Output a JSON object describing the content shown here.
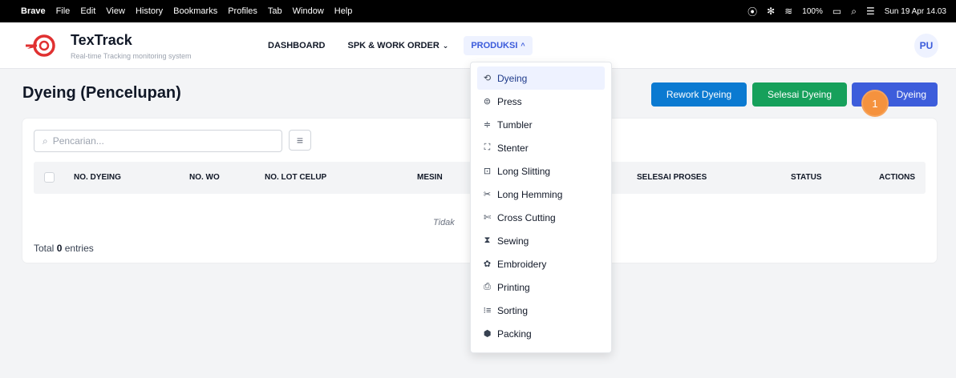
{
  "menubar": {
    "apple": "",
    "app": "Brave",
    "items": [
      "File",
      "Edit",
      "View",
      "History",
      "Bookmarks",
      "Profiles",
      "Tab",
      "Window",
      "Help"
    ],
    "battery": "100%",
    "datetime": "Sun 19 Apr 14.03"
  },
  "header": {
    "brand_name": "TexTrack",
    "brand_tagline": "Real-time Tracking monitoring system",
    "nav": [
      {
        "label": "DASHBOARD"
      },
      {
        "label": "SPK & WORK ORDER",
        "chevron": "⌄"
      },
      {
        "label": "PRODUKSI",
        "chevron": "^"
      }
    ],
    "avatar": "PU",
    "accent": "#3b5bdb"
  },
  "page": {
    "title": "Dyeing (Pencelupan)",
    "buttons": {
      "rework": "Rework Dyeing",
      "selesai": "Selesai Dyeing",
      "dyeing": "Dyeing"
    },
    "badge": "1",
    "search_placeholder": "Pencarian...",
    "columns": [
      "NO. DYEING",
      "NO. WO",
      "NO. LOT CELUP",
      "MESIN",
      "SELESAI PROSES",
      "STATUS",
      "ACTIONS"
    ],
    "empty_text": "Tidak",
    "total_prefix": "Total",
    "total_count": "0",
    "total_suffix": "entries"
  },
  "dropdown": {
    "items": [
      {
        "label": "Dyeing",
        "icon": "dyeing-icon"
      },
      {
        "label": "Press",
        "icon": "press-icon"
      },
      {
        "label": "Tumbler",
        "icon": "tumbler-icon"
      },
      {
        "label": "Stenter",
        "icon": "stenter-icon"
      },
      {
        "label": "Long Slitting",
        "icon": "slitting-icon"
      },
      {
        "label": "Long Hemming",
        "icon": "scissors-icon"
      },
      {
        "label": "Cross Cutting",
        "icon": "cutting-icon"
      },
      {
        "label": "Sewing",
        "icon": "sewing-icon"
      },
      {
        "label": "Embroidery",
        "icon": "embroidery-icon"
      },
      {
        "label": "Printing",
        "icon": "printer-icon"
      },
      {
        "label": "Sorting",
        "icon": "sorting-icon"
      },
      {
        "label": "Packing",
        "icon": "package-icon"
      }
    ]
  }
}
